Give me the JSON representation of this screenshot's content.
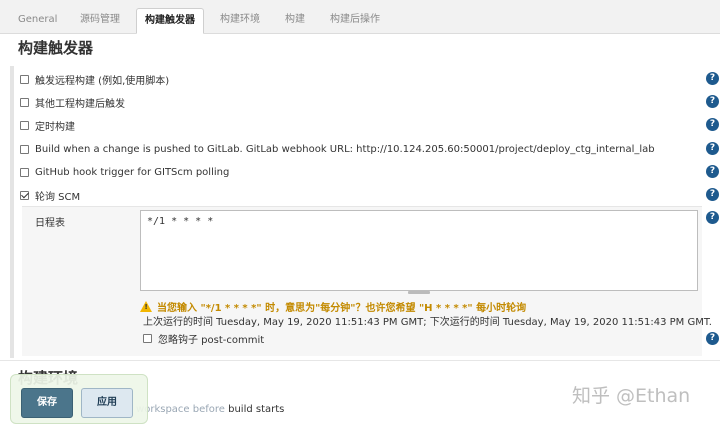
{
  "tabs": [
    {
      "label": "General",
      "active": false
    },
    {
      "label": "源码管理",
      "active": false
    },
    {
      "label": "构建触发器",
      "active": true
    },
    {
      "label": "构建环境",
      "active": false
    },
    {
      "label": "构建",
      "active": false
    },
    {
      "label": "构建后操作",
      "active": false
    }
  ],
  "section_title": "构建触发器",
  "triggers": [
    {
      "label": "触发远程构建 (例如,使用脚本)",
      "checked": false
    },
    {
      "label": "其他工程构建后触发",
      "checked": false
    },
    {
      "label": "定时构建",
      "checked": false
    },
    {
      "label": "Build when a change is pushed to GitLab. GitLab webhook URL: http://10.124.205.60:50001/project/deploy_ctg_internal_lab",
      "checked": false
    },
    {
      "label": "GitHub hook trigger for GITScm polling",
      "checked": false
    },
    {
      "label": "轮询 SCM",
      "checked": true
    }
  ],
  "help_glyph": "?",
  "schedule": {
    "label": "日程表",
    "value": "*/1 * * * *",
    "warning_icon": "warning-icon",
    "warning_glyph": "!",
    "warning": "当您输入 \"*/1 * * * *\" 时，意思为\"每分钟\"？也许您希望 \"H * * * *\" 每小时轮询",
    "run_info": "上次运行的时间 Tuesday, May 19, 2020 11:51:43 PM GMT; 下次运行的时间 Tuesday, May 19, 2020 11:51:43 PM GMT.",
    "ignore_label": "忽略钩子 post-commit",
    "ignore_checked": false
  },
  "next_section_title": "构建环境",
  "under_text_faded": "Delete workspace before",
  "under_text": " build starts",
  "buttons": {
    "save": "保存",
    "apply": "应用"
  },
  "watermark": "知乎 @Ethan",
  "colors": {
    "help": "#1e5a8e",
    "warning": "#c38a00",
    "save": "#4b758b"
  }
}
